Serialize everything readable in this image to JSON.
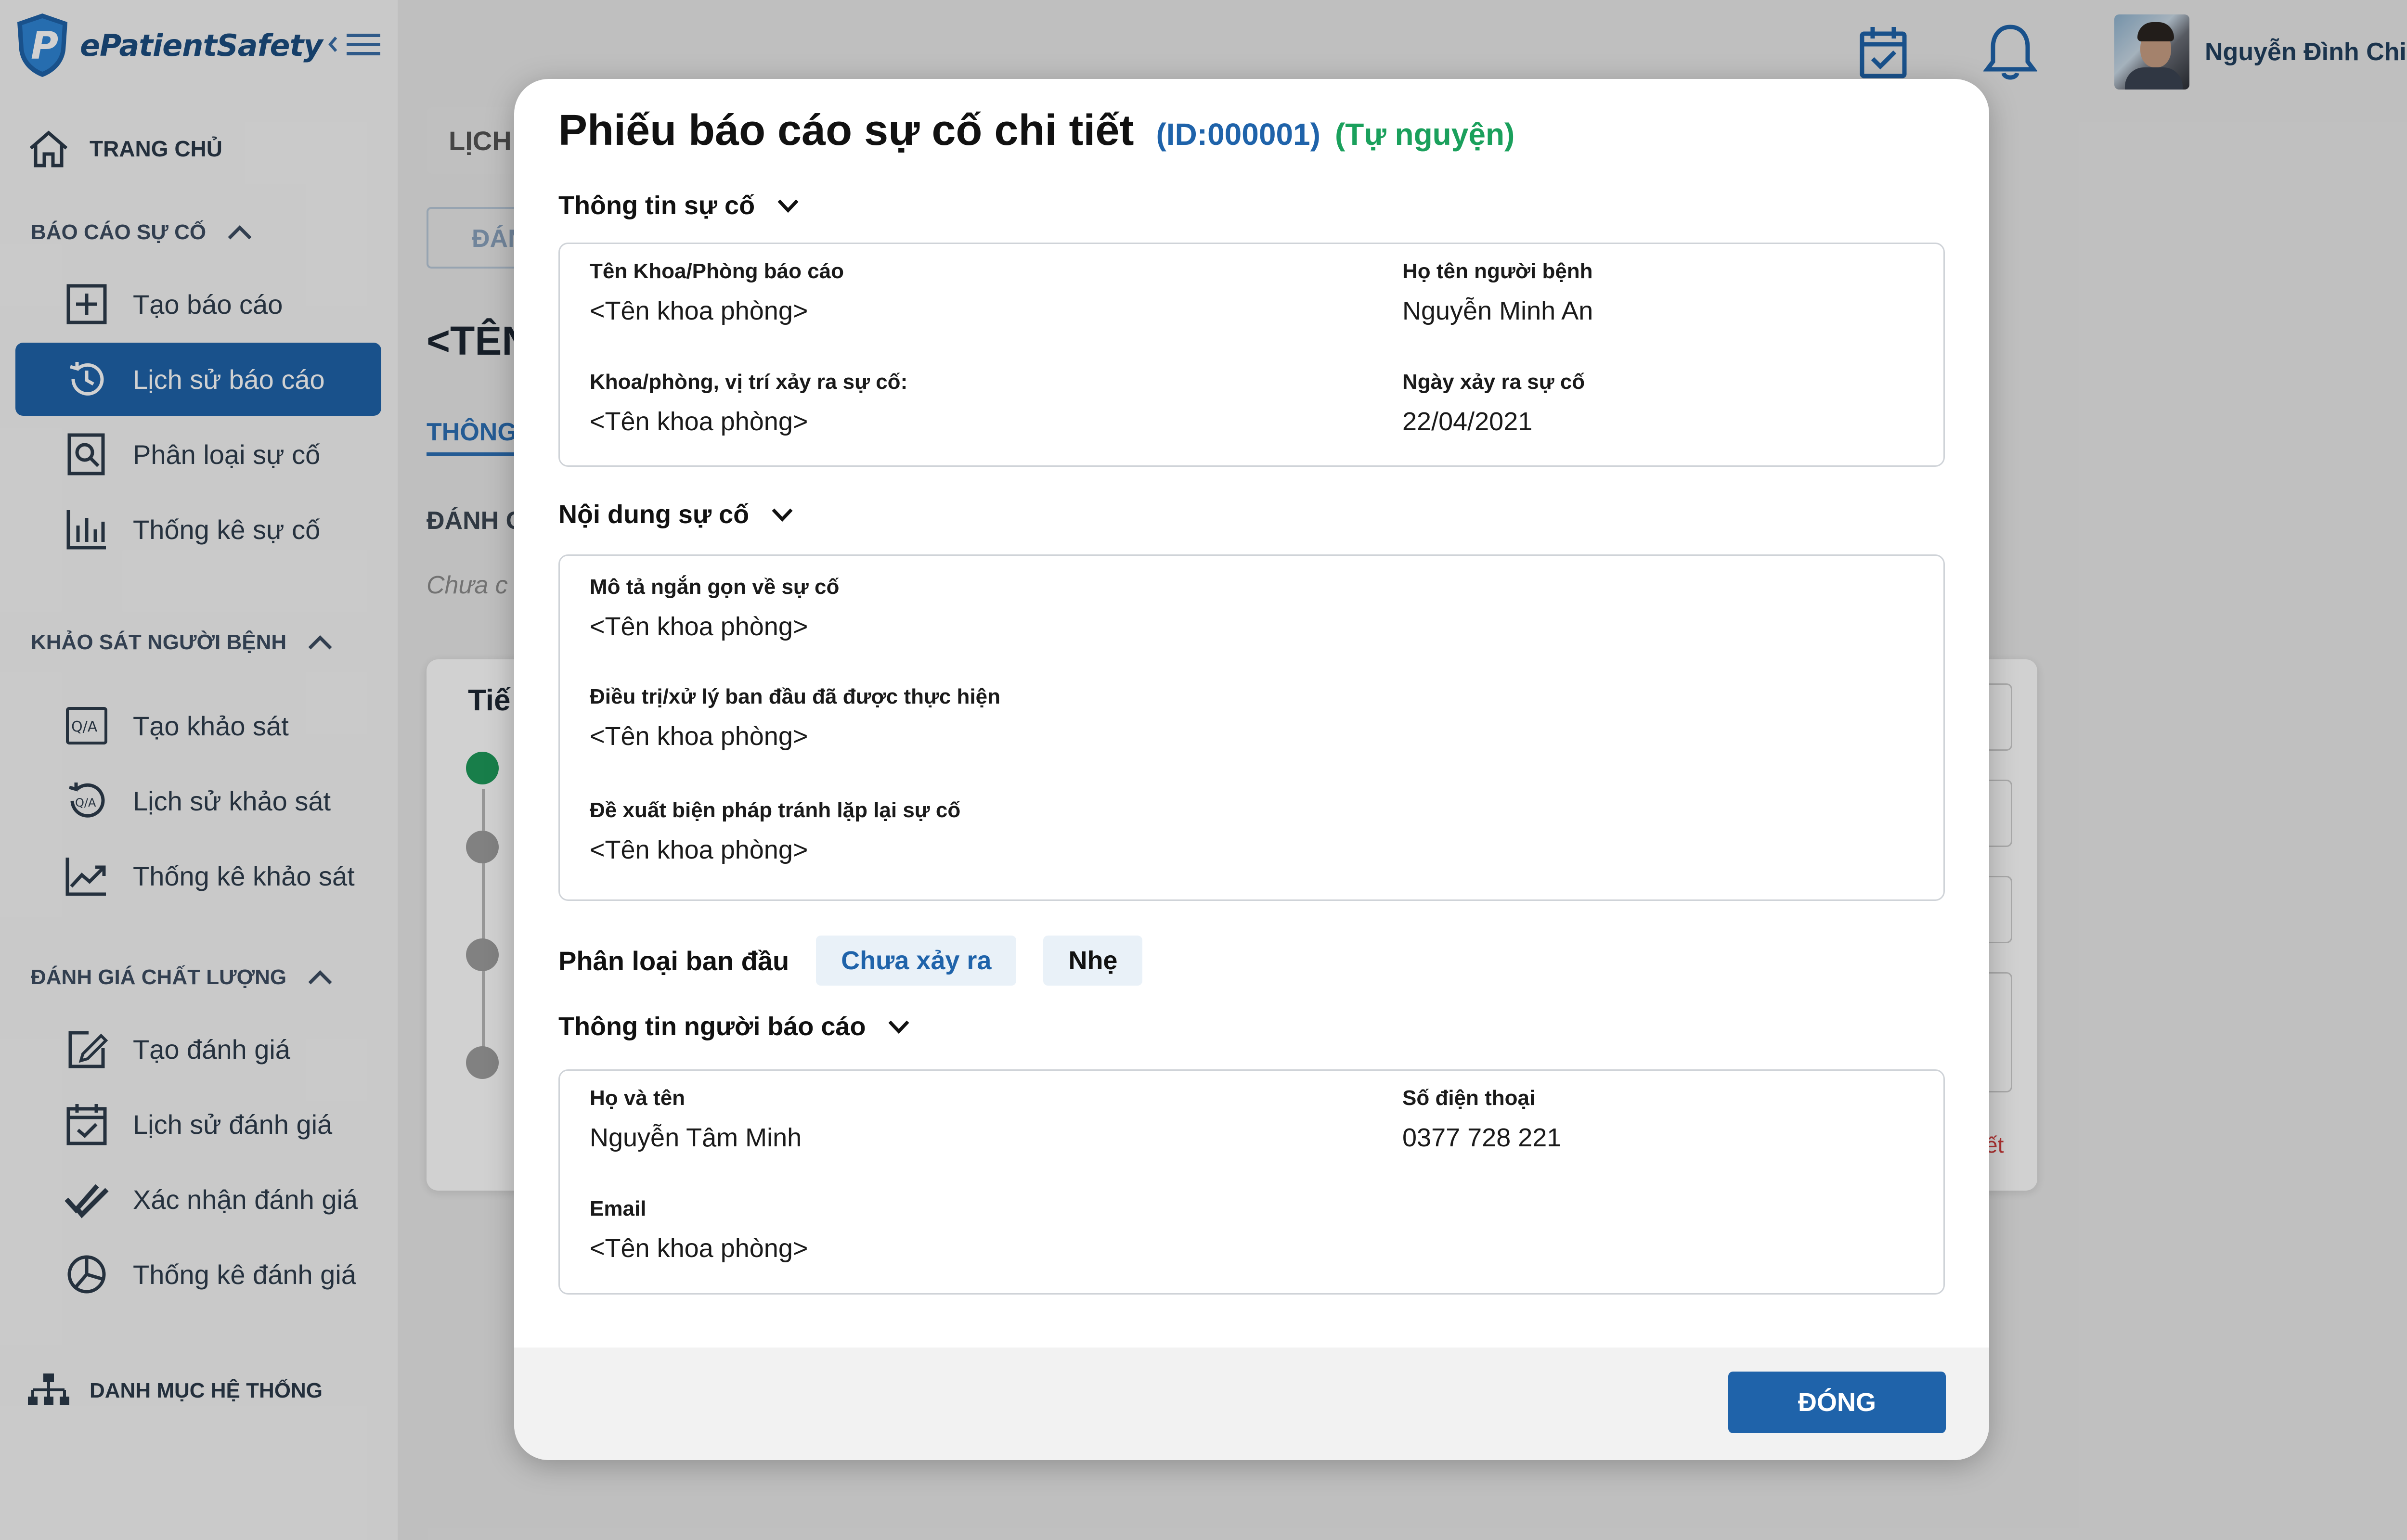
{
  "app": {
    "logo_text": "ePatientSafety"
  },
  "colors": {
    "primary": "#1f63aa",
    "success": "#1aa05c",
    "sidebar_bg": "#f6f6f6"
  },
  "header": {
    "user_name": "Nguyễn Đình Chiện"
  },
  "sidebar": {
    "home": "TRANG CHỦ",
    "sections": [
      {
        "title": "BÁO CÁO SỰ CỐ",
        "items": [
          "Tạo báo cáo",
          "Lịch sử báo cáo",
          "Phân loại sự cố",
          "Thống kê sự cố"
        ]
      },
      {
        "title": "KHẢO SÁT NGƯỜI BỆNH",
        "items": [
          "Tạo khảo sát",
          "Lịch sử khảo sát",
          "Thống kê khảo sát"
        ]
      },
      {
        "title": "ĐÁNH GIÁ CHẤT LƯỢNG",
        "items": [
          "Tạo đánh giá",
          "Lịch sử đánh giá",
          "Xác nhận đánh giá",
          "Thống kê đánh giá"
        ]
      }
    ],
    "system": "DANH MỤC HỆ THỐNG",
    "active_item": "Lịch sử báo cáo"
  },
  "background": {
    "tab": "LỊCH",
    "button": "ĐÁN",
    "title": "<TÊN",
    "tab_nav": "THÔNG",
    "label": "ĐÁNH G",
    "hint": "Chưa c",
    "card_title": "Tiế",
    "red_text": "ết"
  },
  "modal": {
    "title": "Phiếu báo cáo sự cố chi tiết",
    "id": "(ID:000001)",
    "type": "(Tự nguyện)",
    "incident_info": {
      "title": "Thông tin sự cố",
      "fields": [
        {
          "label": "Tên Khoa/Phòng báo cáo",
          "value": "<Tên khoa phòng>"
        },
        {
          "label": "Họ tên người bệnh",
          "value": "Nguyễn Minh An"
        },
        {
          "label": "Khoa/phòng, vị trí xảy ra sự cố:",
          "value": "<Tên khoa phòng>"
        },
        {
          "label": "Ngày xảy ra sự cố",
          "value": "22/04/2021"
        }
      ]
    },
    "content": {
      "title": "Nội dung sự cố",
      "fields": [
        {
          "label": "Mô tả ngắn gọn về sự cố",
          "value": "<Tên khoa phòng>"
        },
        {
          "label": "Điều trị/xử lý ban đầu đã được thực hiện",
          "value": "<Tên khoa phòng>"
        },
        {
          "label": "Đề xuất biện pháp tránh lặp lại sự cố",
          "value": "<Tên khoa phòng>"
        }
      ]
    },
    "classification": {
      "label": "Phân loại ban đầu",
      "chips": [
        "Chưa xảy ra",
        "Nhẹ"
      ]
    },
    "reporter": {
      "title": "Thông tin người báo cáo",
      "fields": [
        {
          "label": "Họ và tên",
          "value": "Nguyễn Tâm Minh"
        },
        {
          "label": "Số điện thoại",
          "value": "0377 728 221"
        },
        {
          "label": "Email",
          "value": "<Tên khoa phòng>"
        }
      ]
    },
    "close_label": "ĐÓNG"
  }
}
